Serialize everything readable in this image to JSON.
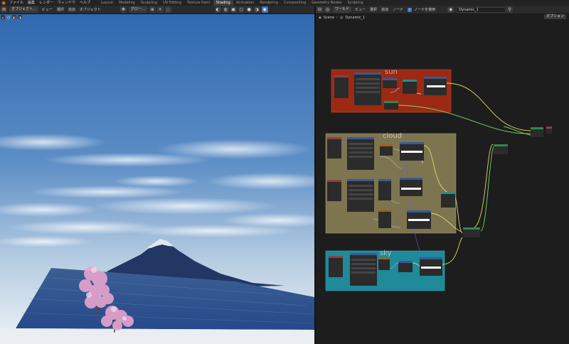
{
  "menubar": {
    "items": [
      "ファイル",
      "編集",
      "レンダー",
      "ウィンドウ",
      "ヘルプ"
    ],
    "workspaces": [
      "Layout",
      "Modeling",
      "Sculpting",
      "UV Editing",
      "Texture Paint",
      "Shading",
      "Animation",
      "Rendering",
      "Compositing",
      "Geometry Nodes",
      "Scripting"
    ],
    "active_workspace": "Shading"
  },
  "viewport": {
    "mode": "オブジェクト...",
    "menu": [
      "ビュー",
      "選択",
      "追加",
      "オブジェクト"
    ],
    "orientation": "グロー...",
    "options": "オプション"
  },
  "node_editor": {
    "type": "ワールド",
    "menu": [
      "ビュー",
      "選択",
      "追加",
      "ノード"
    ],
    "use_nodes_label": "ノードを使用",
    "world_name": "Dynamic_1",
    "breadcrumb": [
      "Scene",
      "Dynamic_1"
    ],
    "frames": [
      {
        "label": "sun",
        "color": "#9b2a14"
      },
      {
        "label": "cloud",
        "color": "#7d7550"
      },
      {
        "label": "sky",
        "color": "#1e8a9a"
      }
    ]
  },
  "colors": {
    "sky_top": "#2f69b0",
    "sky_bottom": "#dfe9f2",
    "water": "#2c4f8a",
    "mountain": "#223763",
    "blossom": "#e8a5cf",
    "accent": "#4772b3"
  }
}
